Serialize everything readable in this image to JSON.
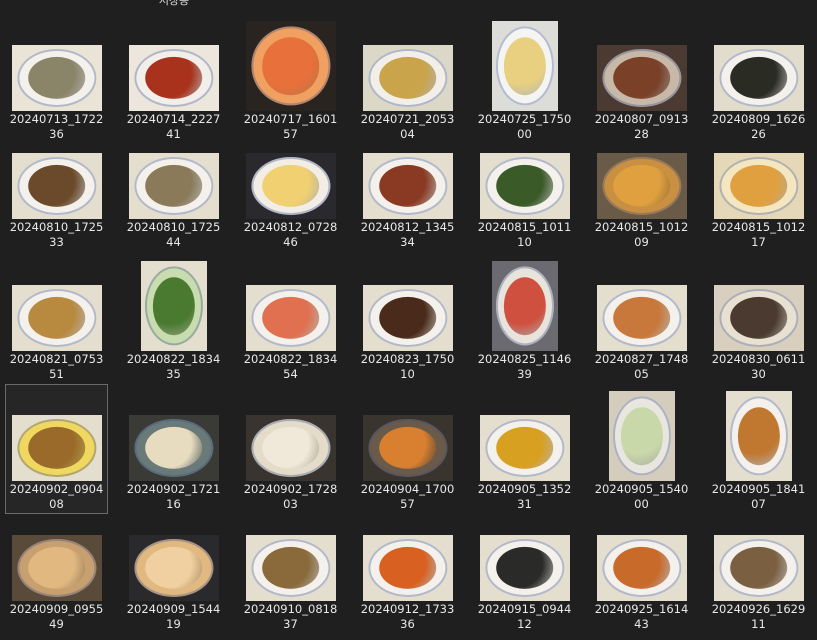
{
  "folder_label": "저장용",
  "files": [
    {
      "name": "20240713_1722\n36",
      "colors": [
        "#e9e4d6",
        "#f4f1ec",
        "#8a8468"
      ]
    },
    {
      "name": "20240714_2227\n41",
      "colors": [
        "#ece6dc",
        "#f2eee9",
        "#a8321c"
      ]
    },
    {
      "name": "20240717_1601\n57",
      "colors": [
        "#2a2420",
        "#f0a060",
        "#e8703a"
      ]
    },
    {
      "name": "20240721_2053\n04",
      "colors": [
        "#dcd8c8",
        "#f2efe9",
        "#c9a44a"
      ]
    },
    {
      "name": "20240725_1750\n00",
      "colors": [
        "#dcdcd8",
        "#f4f4f2",
        "#e8d080"
      ]
    },
    {
      "name": "20240807_0913\n28",
      "colors": [
        "#4a3a32",
        "#c8b8a8",
        "#7a4028"
      ]
    },
    {
      "name": "20240809_1626\n26",
      "colors": [
        "#e2dccc",
        "#f4f1ec",
        "#2a2c24"
      ]
    },
    {
      "name": "20240810_1725\n33",
      "colors": [
        "#e4dece",
        "#f4f1ec",
        "#6a4a2a"
      ]
    },
    {
      "name": "20240810_1725\n44",
      "colors": [
        "#e4dece",
        "#f4f1ec",
        "#8a7a5a"
      ]
    },
    {
      "name": "20240812_0728\n46",
      "colors": [
        "#2a2a2e",
        "#f2eee6",
        "#f0d070"
      ]
    },
    {
      "name": "20240812_1345\n34",
      "colors": [
        "#e4dece",
        "#f4f1ec",
        "#8a3a22"
      ]
    },
    {
      "name": "20240815_1011\n10",
      "colors": [
        "#e4dece",
        "#f4f1ec",
        "#3a5a28"
      ]
    },
    {
      "name": "20240815_1012\n09",
      "colors": [
        "#6a5a48",
        "#c89040",
        "#e0a040"
      ]
    },
    {
      "name": "20240815_1012\n17",
      "colors": [
        "#e4d8b8",
        "#f4e6c0",
        "#e0a040"
      ]
    },
    {
      "name": "20240821_0753\n51",
      "colors": [
        "#e4dece",
        "#f4f1ec",
        "#b88a40"
      ]
    },
    {
      "name": "20240822_1834\n35",
      "colors": [
        "#e4dece",
        "#c8dcb0",
        "#4a7a30"
      ]
    },
    {
      "name": "20240822_1834\n54",
      "colors": [
        "#e4dece",
        "#f4f1ec",
        "#e07050"
      ]
    },
    {
      "name": "20240823_1750\n10",
      "colors": [
        "#e4dece",
        "#f4f1ec",
        "#4a2a1a"
      ]
    },
    {
      "name": "20240825_1146\n39",
      "colors": [
        "#6a6a70",
        "#e8e4dc",
        "#d05040"
      ]
    },
    {
      "name": "20240827_1748\n05",
      "colors": [
        "#e4dece",
        "#f4f1ec",
        "#c8783a"
      ]
    },
    {
      "name": "20240830_0611\n30",
      "colors": [
        "#d8cfbf",
        "#e8e0d0",
        "#4a3a30"
      ]
    },
    {
      "name": "20240902_0904\n08",
      "colors": [
        "#e4dece",
        "#f0d860",
        "#9a6a2a"
      ]
    },
    {
      "name": "20240902_1721\n16",
      "colors": [
        "#3a3a36",
        "#6a7a78",
        "#e8dcc0"
      ]
    },
    {
      "name": "20240902_1728\n03",
      "colors": [
        "#3a3430",
        "#e4dcc8",
        "#f0e8d8"
      ]
    },
    {
      "name": "20240904_1700\n57",
      "colors": [
        "#3a342e",
        "#6a5a4a",
        "#d88030"
      ]
    },
    {
      "name": "20240905_1352\n31",
      "colors": [
        "#e4dece",
        "#f4f1ec",
        "#d8a020"
      ]
    },
    {
      "name": "20240905_1540\n00",
      "colors": [
        "#d4ccbc",
        "#e8e6de",
        "#c8d8a8"
      ]
    },
    {
      "name": "20240905_1841\n07",
      "colors": [
        "#e4dece",
        "#f4f1ec",
        "#c07830"
      ]
    },
    {
      "name": "20240909_0955\n49",
      "colors": [
        "#5a4a3a",
        "#c8a070",
        "#e0b880"
      ]
    },
    {
      "name": "20240909_1544\n19",
      "colors": [
        "#2a2a2c",
        "#e0b880",
        "#f0d0a0"
      ]
    },
    {
      "name": "20240910_0818\n37",
      "colors": [
        "#e4dece",
        "#f4f1ec",
        "#8a6a3a"
      ]
    },
    {
      "name": "20240912_1733\n36",
      "colors": [
        "#e4dece",
        "#f4f1ec",
        "#d86020"
      ]
    },
    {
      "name": "20240915_0944\n12",
      "colors": [
        "#e4dece",
        "#f4f1ec",
        "#2a2a28"
      ]
    },
    {
      "name": "20240925_1614\n43",
      "colors": [
        "#e4dece",
        "#f4f1ec",
        "#c86a2a"
      ]
    },
    {
      "name": "20240926_1629\n11",
      "colors": [
        "#e4dece",
        "#f4f1ec",
        "#7a6040"
      ]
    }
  ],
  "selected_index": 21
}
